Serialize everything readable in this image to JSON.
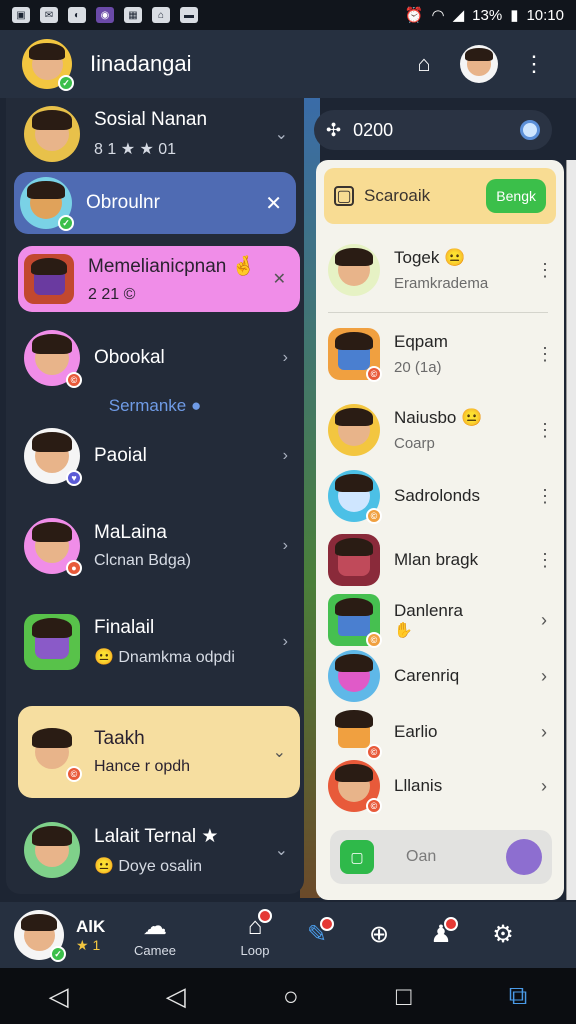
{
  "status_bar": {
    "time": "10:10",
    "battery": "13%"
  },
  "header": {
    "title": "Iinadangai"
  },
  "left_list": {
    "items": [
      {
        "name": "Sosial Nanan",
        "sub": "8 1 ★ ★ 01",
        "color": "#e8c14a"
      },
      {
        "name": "Obroulnr",
        "sub": "",
        "color": "#7ad2e6"
      },
      {
        "name": "Memelianicpnan 🤞",
        "sub": "2 21 ©",
        "color": "#c2482f"
      },
      {
        "name": "Obookal",
        "sub": "",
        "color": "#f08de8"
      },
      {
        "name": "Paoial",
        "sub": "",
        "color": "#f5f5f5"
      },
      {
        "name": "MaLaina",
        "sub": "Clcnan Bdga)",
        "color": "#f08de8"
      },
      {
        "name": "Finalail",
        "sub": "😐 Dnamkma odpdi",
        "color": "#58c24a"
      },
      {
        "name": "Taakh",
        "sub": "Hance r opdh",
        "color": "#f6dea0"
      },
      {
        "name": "Lalait Ternal ★",
        "sub": "😐 Doye osalin",
        "color": "#7fd18a"
      }
    ],
    "separator": "Sermanke ●"
  },
  "search": {
    "value": "0200"
  },
  "right_panel": {
    "top_label": "Scaroaik",
    "top_button": "Bengk",
    "items": [
      {
        "name": "Togek 😐",
        "sub": "Eramkradema",
        "color": "#e6f2c4"
      },
      {
        "name": "Eqpam",
        "sub": "20 (1a)",
        "color": "#f0a040"
      },
      {
        "name": "Naiusbo 😐",
        "sub": "Coarp",
        "color": "#f3c640"
      },
      {
        "name": "Sadrolonds",
        "sub": "",
        "color": "#4cc0e6"
      },
      {
        "name": "Mlan bragk",
        "sub": "",
        "color": "#8a2a3a"
      },
      {
        "name": "Danlenra",
        "sub": "✋",
        "color": "#46c050"
      },
      {
        "name": "Carenriq",
        "sub": "",
        "color": "#5fb8e8"
      },
      {
        "name": "Earlio",
        "sub": "",
        "color": "#f4f3ec"
      },
      {
        "name": "Lllanis",
        "sub": "",
        "color": "#e85a3a"
      }
    ],
    "bottom_label": "Oan"
  },
  "bottom_nav": {
    "profile_name": "AlK",
    "profile_sub": "★ 1",
    "items": [
      {
        "label": "Camee",
        "icon": "cloud-icon"
      },
      {
        "label": "Loop",
        "icon": "home-icon"
      },
      {
        "label": "",
        "icon": "pen-icon"
      },
      {
        "label": "",
        "icon": "compass-icon"
      },
      {
        "label": "",
        "icon": "user-icon"
      },
      {
        "label": "",
        "icon": "gear-icon"
      }
    ]
  },
  "colors": {
    "accent_green": "#3bbf4a",
    "accent_pink": "#f08de8",
    "accent_blue": "#4f6bb3"
  }
}
